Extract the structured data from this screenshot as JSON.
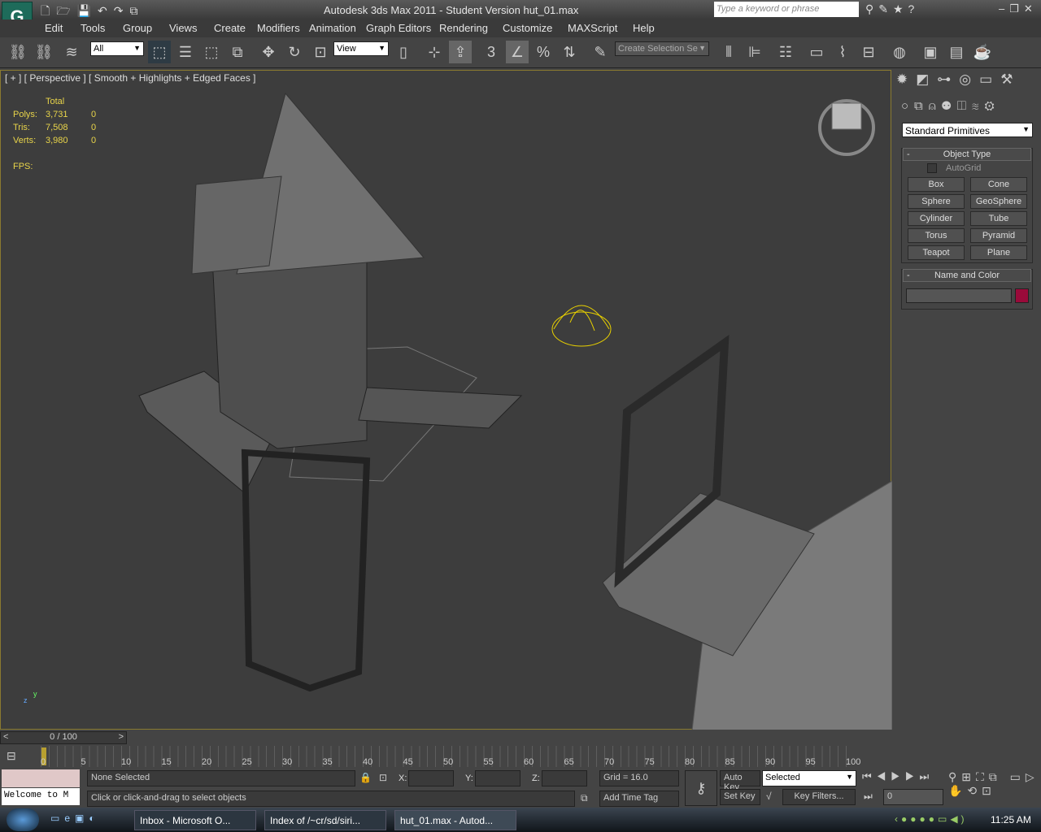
{
  "window": {
    "title": "Autodesk 3ds Max  2011   - Student Version    hut_01.max",
    "search_placeholder": "Type a keyword or phrase"
  },
  "menu": [
    "Edit",
    "Tools",
    "Group",
    "Views",
    "Create",
    "Modifiers",
    "Animation",
    "Graph Editors",
    "Rendering",
    "Customize",
    "MAXScript",
    "Help"
  ],
  "toolbar": {
    "selection_filter": "All",
    "reference_coord": "View",
    "named_selection": "Create Selection Se",
    "snap_label": "3"
  },
  "viewport": {
    "label": "[ + ] [ Perspective ] [ Smooth + Highlights + Edged Faces ]",
    "stats": {
      "header": "Total",
      "rows": [
        {
          "label": "Polys:",
          "total": "3,731",
          "sel": "0"
        },
        {
          "label": "Tris:",
          "total": "7,508",
          "sel": "0"
        },
        {
          "label": "Verts:",
          "total": "3,980",
          "sel": "0"
        }
      ],
      "fps": "FPS:"
    },
    "selection_color": "#e8d000"
  },
  "panel": {
    "dropdown": "Standard Primitives",
    "object_type": "Object Type",
    "autogrid": "AutoGrid",
    "buttons": [
      "Box",
      "Cone",
      "Sphere",
      "GeoSphere",
      "Cylinder",
      "Tube",
      "Torus",
      "Pyramid",
      "Teapot",
      "Plane"
    ],
    "name_color": "Name and Color",
    "object_color": "#9a0a3a"
  },
  "timeline": {
    "frame": "0 / 100",
    "ticks": [
      "0",
      "5",
      "10",
      "15",
      "20",
      "25",
      "30",
      "35",
      "40",
      "45",
      "50",
      "55",
      "60",
      "65",
      "70",
      "75",
      "80",
      "85",
      "90",
      "95",
      "100"
    ]
  },
  "status": {
    "selection": "None Selected",
    "prompt": "Click or click-and-drag to select objects",
    "x_label": "X:",
    "y_label": "Y:",
    "z_label": "Z:",
    "grid": "Grid = 16.0",
    "add_time_tag": "Add Time Tag",
    "auto_key": "Auto Key",
    "set_key": "Set Key",
    "key_mode": "Selected",
    "key_filters": "Key Filters...",
    "current_frame": "0",
    "listener": "Welcome to M"
  },
  "taskbar": {
    "tasks": [
      "Inbox - Microsoft O...",
      "Index of /~cr/sd/siri...",
      "hut_01.max - Autod..."
    ],
    "clock": "11:25 AM"
  }
}
